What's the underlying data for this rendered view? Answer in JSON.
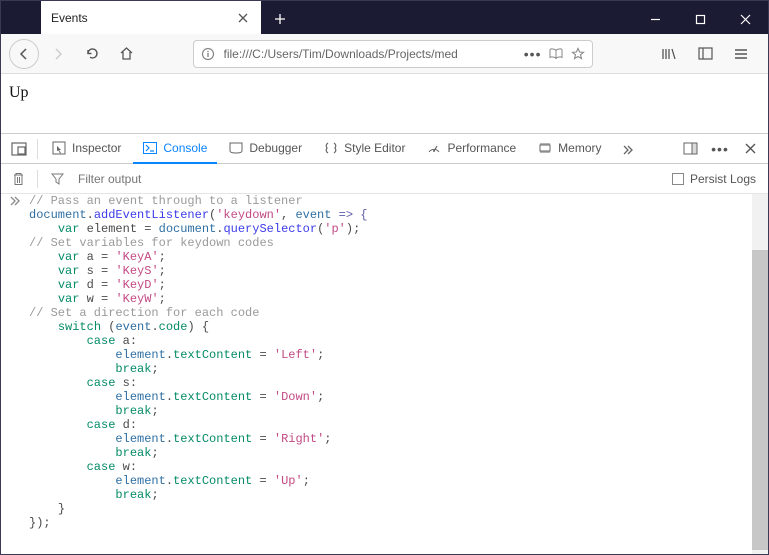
{
  "window": {
    "tab_title": "Events",
    "url": "file:///C:/Users/Tim/Downloads/Projects/med"
  },
  "content": {
    "text": "Up"
  },
  "devtools": {
    "tabs": {
      "inspector": "Inspector",
      "console": "Console",
      "debugger": "Debugger",
      "style": "Style Editor",
      "performance": "Performance",
      "memory": "Memory"
    },
    "filter_placeholder": "Filter output",
    "persist_label": "Persist Logs"
  },
  "code": {
    "c1": "// Pass an event through to a listener",
    "l2a": "document",
    "l2b": ".",
    "l2c": "addEventListener",
    "l2d": "(",
    "l2e": "'keydown'",
    "l2f": ", ",
    "l2g": "event",
    "l2h": " => {",
    "l3a": "var",
    "l3b": " element = ",
    "l3c": "document",
    "l3d": ".",
    "l3e": "querySelector",
    "l3f": "(",
    "l3g": "'p'",
    "l3h": ");",
    "c4": "// Set variables for keydown codes",
    "l5a": "var",
    "l5b": " a = ",
    "l5c": "'KeyA'",
    "l5d": ";",
    "l6a": "var",
    "l6b": " s = ",
    "l6c": "'KeyS'",
    "l6d": ";",
    "l7a": "var",
    "l7b": " d = ",
    "l7c": "'KeyD'",
    "l7d": ";",
    "l8a": "var",
    "l8b": " w = ",
    "l8c": "'KeyW'",
    "l8d": ";",
    "c9": "// Set a direction for each code",
    "l10a": "switch",
    "l10b": " (",
    "l10c": "event",
    "l10d": ".",
    "l10e": "code",
    "l10f": ") {",
    "l11a": "case",
    "l11b": " a:",
    "l12a": "element",
    "l12b": ".",
    "l12c": "textContent",
    "l12d": " = ",
    "l12e": "'Left'",
    "l12f": ";",
    "l13a": "break",
    "l13b": ";",
    "l14a": "case",
    "l14b": " s:",
    "l15a": "element",
    "l15b": ".",
    "l15c": "textContent",
    "l15d": " = ",
    "l15e": "'Down'",
    "l15f": ";",
    "l16a": "break",
    "l16b": ";",
    "l17a": "case",
    "l17b": " d:",
    "l18a": "element",
    "l18b": ".",
    "l18c": "textContent",
    "l18d": " = ",
    "l18e": "'Right'",
    "l18f": ";",
    "l19a": "break",
    "l19b": ";",
    "l20a": "case",
    "l20b": " w:",
    "l21a": "element",
    "l21b": ".",
    "l21c": "textContent",
    "l21d": " = ",
    "l21e": "'Up'",
    "l21f": ";",
    "l22a": "break",
    "l22b": ";",
    "l23": "}",
    "l24": "});"
  }
}
